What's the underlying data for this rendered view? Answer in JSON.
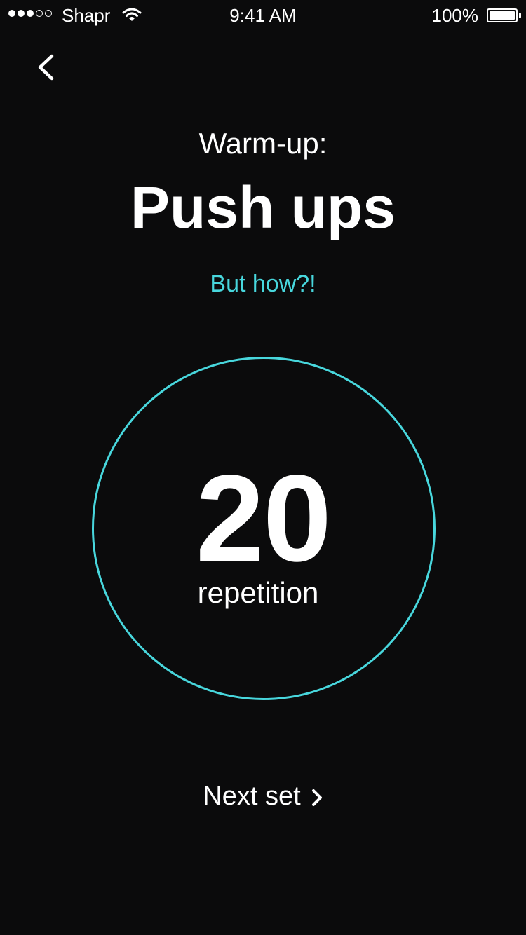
{
  "status_bar": {
    "carrier": "Shapr",
    "signal_bars": 3,
    "signal_total": 5,
    "time": "9:41 AM",
    "battery": "100%",
    "battery_level": 1.0
  },
  "header": {
    "back_icon": "chevron-left-icon"
  },
  "exercise": {
    "subtitle": "Warm-up:",
    "title": "Push ups",
    "help_link": "But how?!"
  },
  "counter": {
    "value": "20",
    "label": "repetition"
  },
  "footer": {
    "next_label": "Next set",
    "next_icon": "chevron-right-icon"
  },
  "colors": {
    "background": "#0b0b0c",
    "accent": "#48d7dd",
    "text": "#ffffff"
  }
}
